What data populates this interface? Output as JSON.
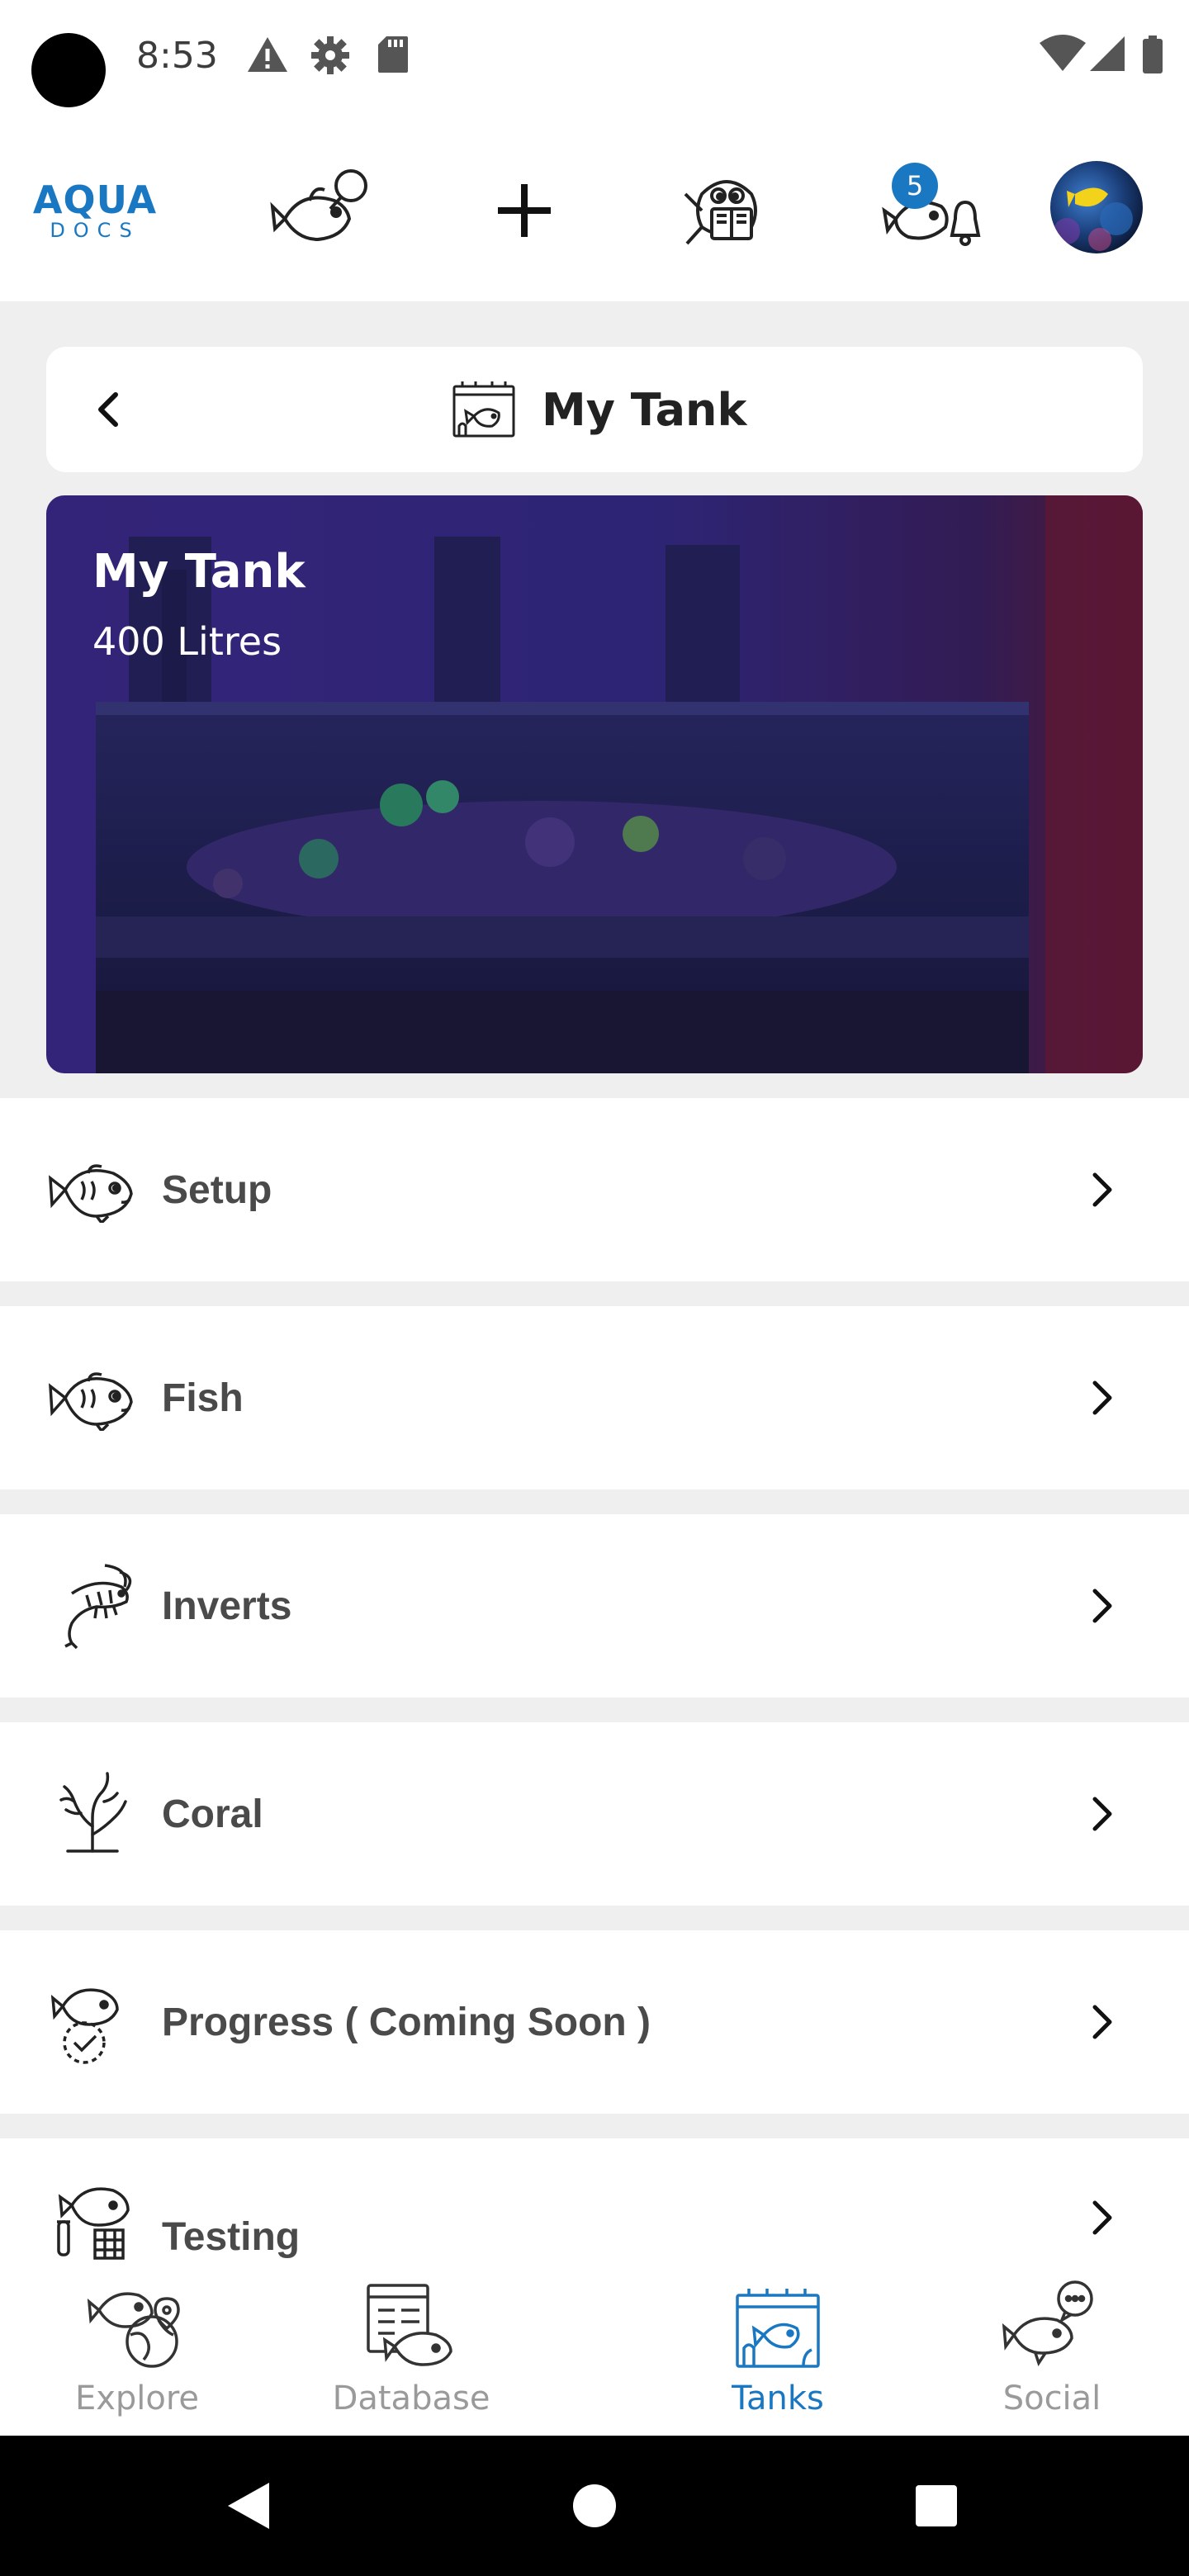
{
  "status_bar": {
    "time": "8:53",
    "icons": [
      "warning-icon",
      "settings-gear-icon",
      "sd-card-icon",
      "wifi-icon",
      "signal-icon",
      "battery-icon"
    ]
  },
  "header": {
    "logo_top": "AQUA",
    "logo_bottom": "DOCS",
    "notification_count": "5",
    "accent_color": "#1a78c2"
  },
  "title_bar": {
    "title": "My Tank"
  },
  "tank": {
    "name": "My Tank",
    "volume": "400 Litres"
  },
  "menu": {
    "items": [
      {
        "label": "Setup",
        "icon": "fish-icon"
      },
      {
        "label": "Fish",
        "icon": "fish-icon"
      },
      {
        "label": "Inverts",
        "icon": "shrimp-icon"
      },
      {
        "label": "Coral",
        "icon": "coral-icon"
      },
      {
        "label": "Progress ( Coming Soon )",
        "icon": "fish-progress-icon"
      },
      {
        "label": "Testing",
        "icon": "fish-testing-icon"
      }
    ]
  },
  "bottom_nav": {
    "items": [
      {
        "label": "Explore",
        "active": false
      },
      {
        "label": "Database",
        "active": false
      },
      {
        "label": "Tanks",
        "active": true
      },
      {
        "label": "Social",
        "active": false
      }
    ]
  }
}
